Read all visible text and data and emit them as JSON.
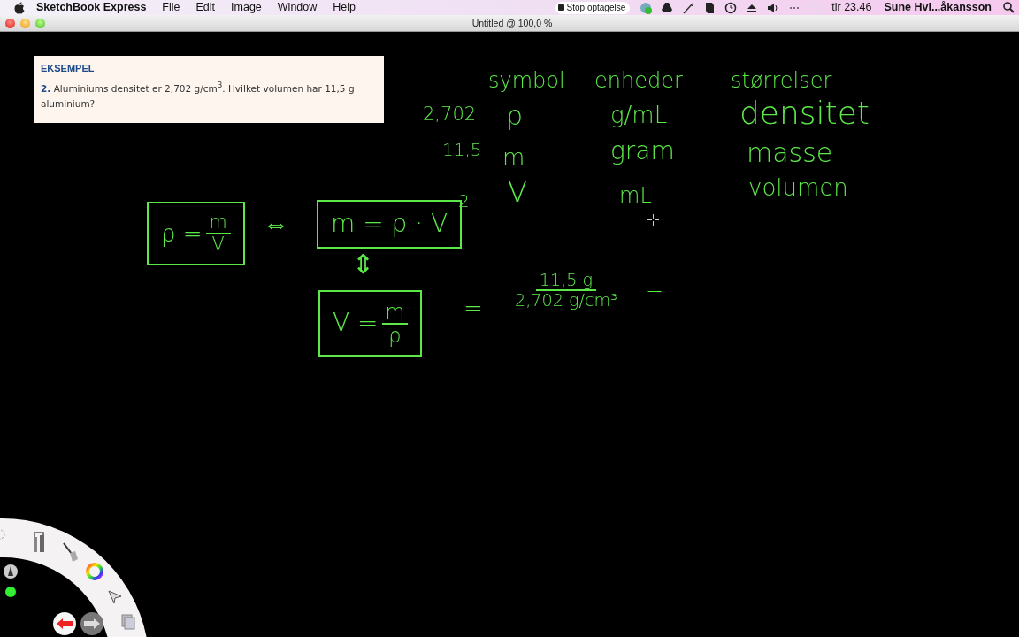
{
  "menu_bar": {
    "app_name": "SketchBook Express",
    "menus": [
      "File",
      "Edit",
      "Image",
      "Window",
      "Help"
    ],
    "recording": "Stop optagelse",
    "clock": "tir 23.46",
    "user": "Sune Hvi...åkansson"
  },
  "window": {
    "title": "Untitled @ 100,0 %"
  },
  "example": {
    "heading": "EKSEMPEL",
    "text": "**2.** Aluminiums densitet er 2,702 g/cm$^{3}$. Hvilket volumen har 11,5 g aluminium?"
  },
  "handwriting": [
    {
      "kind": "word",
      "text": "symbol"
    },
    {
      "kind": "word",
      "text": "enheder"
    },
    {
      "kind": "word",
      "text": "størrelser"
    },
    {
      "kind": "word",
      "text": "2,702"
    },
    {
      "kind": "word",
      "text": "ρ"
    },
    {
      "kind": "word",
      "text": "g/mL"
    },
    {
      "kind": "word",
      "text": "densitet"
    },
    {
      "kind": "word",
      "text": "11,5"
    },
    {
      "kind": "word",
      "text": "m"
    },
    {
      "kind": "word",
      "text": "gram"
    },
    {
      "kind": "word",
      "text": "masse"
    },
    {
      "kind": "word",
      "text": "2"
    },
    {
      "kind": "word",
      "text": "V"
    },
    {
      "kind": "word",
      "text": "mL"
    },
    {
      "kind": "word",
      "text": "volumen"
    },
    {
      "kind": "fraction",
      "prefix": "ρ =",
      "numerator": "m",
      "denominator": "V",
      "boxed": true
    },
    {
      "kind": "word",
      "text": "⇔"
    },
    {
      "kind": "word",
      "text": "m = ρ · V",
      "boxed": true
    },
    {
      "kind": "word",
      "text": "⇕"
    },
    {
      "kind": "fraction",
      "prefix": "V =",
      "numerator": "m",
      "denominator": "ρ",
      "boxed": true
    },
    {
      "kind": "word",
      "text": "="
    },
    {
      "kind": "fraction",
      "numerator": "11,5 g",
      "denominator": "2,702 g/cm³",
      "boxed": false
    },
    {
      "kind": "word",
      "text": "="
    }
  ]
}
